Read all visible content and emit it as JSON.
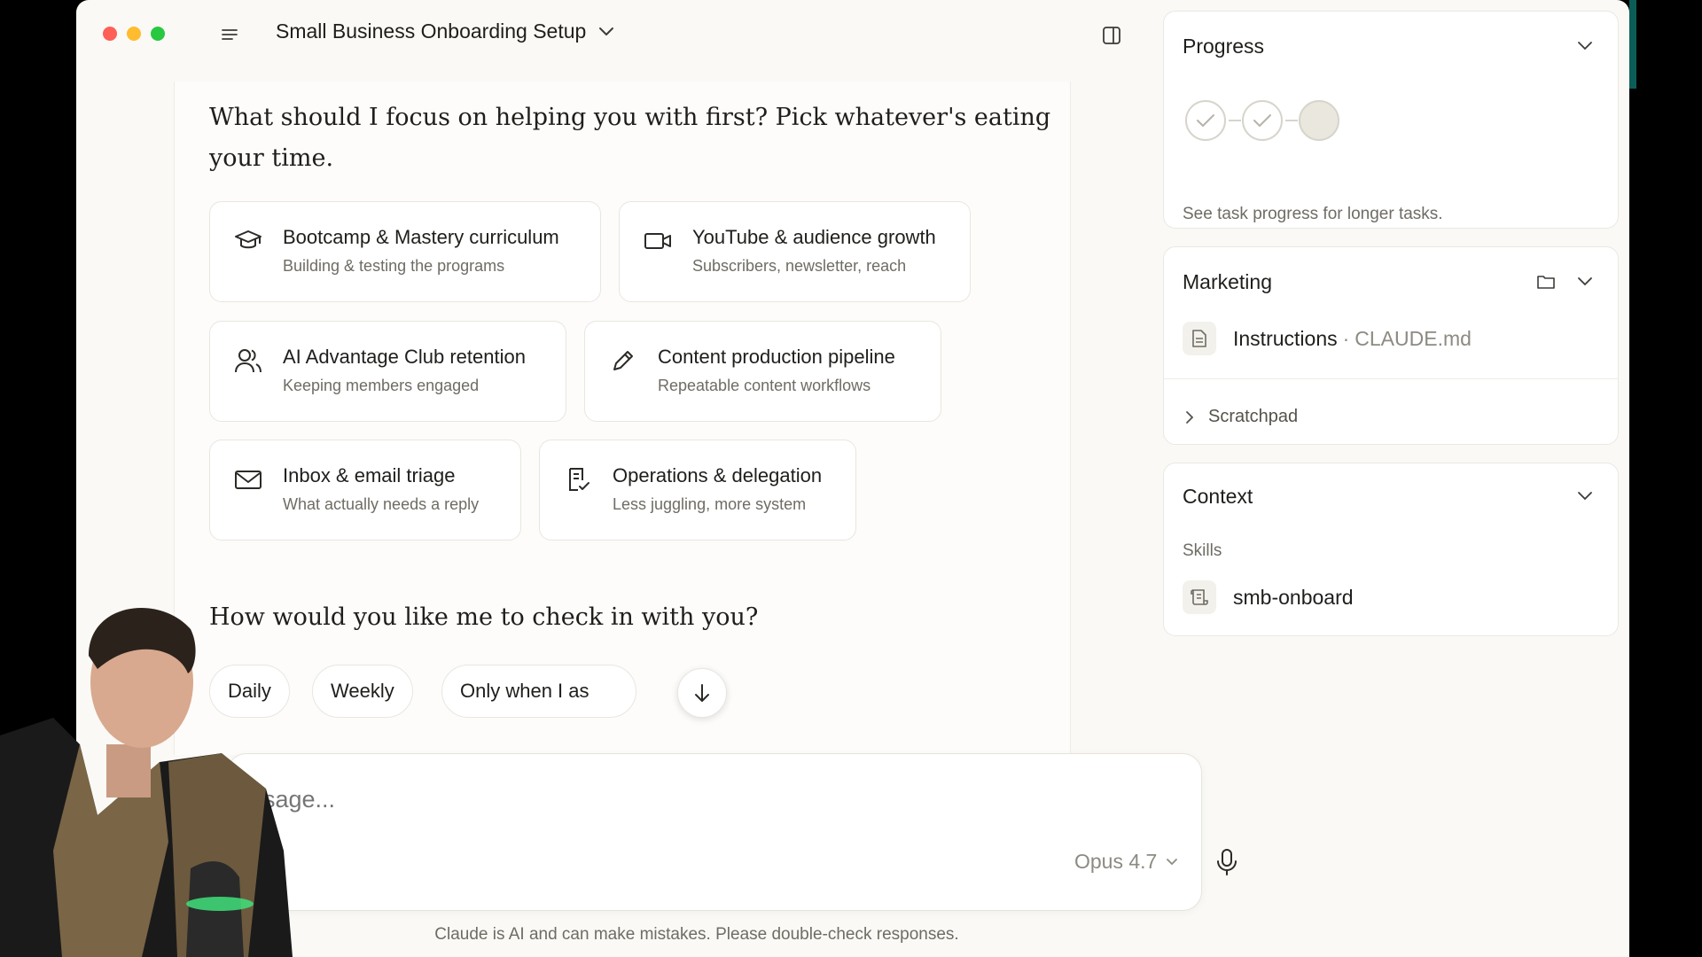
{
  "titlebar": {
    "title": "Small Business Onboarding Setup"
  },
  "chat": {
    "question1": "What should I focus on helping you with first? Pick whatever's eating your time.",
    "options": [
      {
        "title": "Bootcamp & Mastery curriculum",
        "subtitle": "Building & testing the programs",
        "icon": "graduation-cap-icon"
      },
      {
        "title": "YouTube & audience growth",
        "subtitle": "Subscribers, newsletter, reach",
        "icon": "video-camera-icon"
      },
      {
        "title": "AI Advantage Club retention",
        "subtitle": "Keeping members engaged",
        "icon": "users-icon"
      },
      {
        "title": "Content production pipeline",
        "subtitle": "Repeatable content workflows",
        "icon": "pencil-icon"
      },
      {
        "title": "Inbox & email triage",
        "subtitle": "What actually needs a reply",
        "icon": "mail-icon"
      },
      {
        "title": "Operations & delegation",
        "subtitle": "Less juggling, more system",
        "icon": "clipboard-check-icon"
      }
    ],
    "question2": "How would you like me to check in with you?",
    "frequency_options": [
      "Daily",
      "Weekly",
      "Only when I as"
    ]
  },
  "composer": {
    "placeholder": "sage...",
    "model": "Opus 4.7",
    "disclaimer": "Claude is AI and can make mistakes. Please double-check responses."
  },
  "progress": {
    "title": "Progress",
    "steps": [
      "done",
      "done",
      "pending"
    ],
    "description": "See task progress for longer tasks."
  },
  "marketing": {
    "title": "Marketing",
    "file_name": "Instructions",
    "file_separator": "·",
    "file_path": "CLAUDE.md",
    "scratchpad": "Scratchpad"
  },
  "context": {
    "title": "Context",
    "section_label": "Skills",
    "skill": "smb-onboard"
  },
  "colors": {
    "background": "#faf9f5",
    "card_border": "#e8e6df",
    "traffic_red": "#fe5f57",
    "traffic_yellow": "#febc2e",
    "traffic_green": "#28c840"
  }
}
